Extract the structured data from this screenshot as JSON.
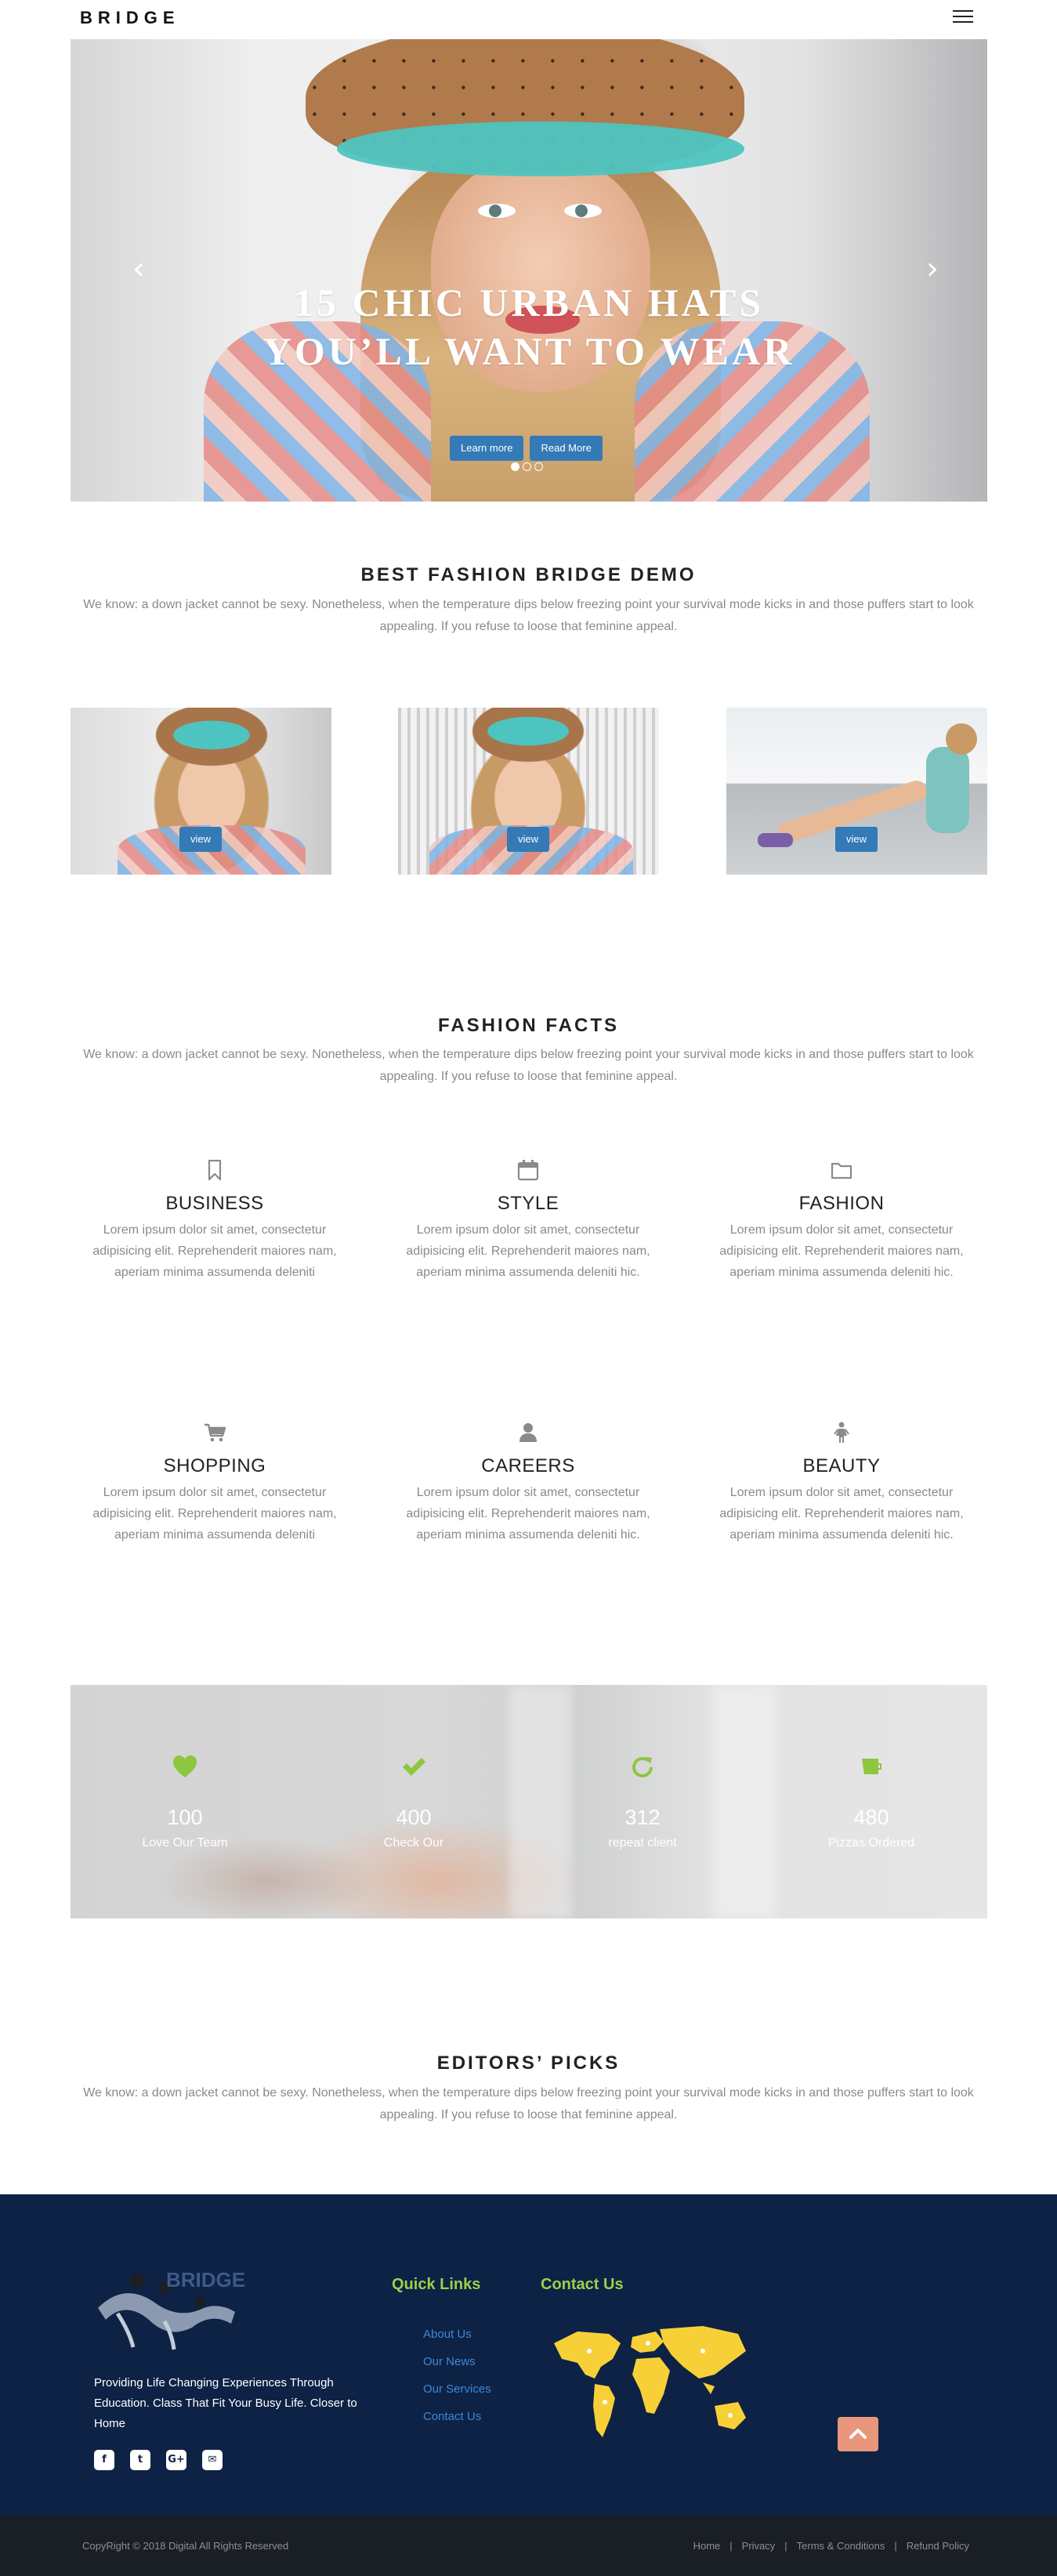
{
  "header": {
    "logo": "BRIDGE",
    "menu_icon": "hamburger-menu-icon"
  },
  "hero": {
    "title": "15 CHIC URBAN HATS YOU’LL WANT TO WEAR",
    "buttons": [
      "Learn more",
      "Read More"
    ],
    "prev_icon": "chevron-left-icon",
    "next_icon": "chevron-right-icon",
    "slides_total": 3,
    "active_slide": 1
  },
  "intro": {
    "title": "BEST FASHION BRIDGE DEMO",
    "description": "We know: a down jacket cannot be sexy. Nonetheless, when the temperature dips below freezing point your survival mode kicks in and those puffers start to look appealing. If you refuse to loose that feminine appeal."
  },
  "gallery": {
    "items": [
      {
        "button": "view"
      },
      {
        "button": "view"
      },
      {
        "button": "view"
      }
    ]
  },
  "facts": {
    "title": "FASHION FACTS",
    "description": "We know: a down jacket cannot be sexy. Nonetheless, when the temperature dips below freezing point your survival mode kicks in and those puffers start to look appealing. If you refuse to loose that feminine appeal.",
    "items": [
      {
        "icon": "bookmark-icon",
        "title": "BUSINESS",
        "text": "Lorem ipsum dolor sit amet, consectetur adipisicing elit. Reprehenderit maiores nam, aperiam minima assumenda deleniti"
      },
      {
        "icon": "calendar-icon",
        "title": "STYLE",
        "text": "Lorem ipsum dolor sit amet, consectetur adipisicing elit. Reprehenderit maiores nam, aperiam minima assumenda deleniti hic."
      },
      {
        "icon": "folder-icon",
        "title": "FASHION",
        "text": "Lorem ipsum dolor sit amet, consectetur adipisicing elit. Reprehenderit maiores nam, aperiam minima assumenda deleniti hic."
      },
      {
        "icon": "shopping-cart-icon",
        "title": "SHOPPING",
        "text": "Lorem ipsum dolor sit amet, consectetur adipisicing elit. Reprehenderit maiores nam, aperiam minima assumenda deleniti"
      },
      {
        "icon": "user-icon",
        "title": "CAREERS",
        "text": "Lorem ipsum dolor sit amet, consectetur adipisicing elit. Reprehenderit maiores nam, aperiam minima assumenda deleniti hic."
      },
      {
        "icon": "female-icon",
        "title": "BEAUTY",
        "text": "Lorem ipsum dolor sit amet, consectetur adipisicing elit. Reprehenderit maiores nam, aperiam minima assumenda deleniti hic."
      }
    ]
  },
  "stats": {
    "items": [
      {
        "icon": "heart-icon",
        "value": "100",
        "label": "Love Our Team"
      },
      {
        "icon": "check-icon",
        "value": "400",
        "label": "Check Our"
      },
      {
        "icon": "refresh-icon",
        "value": "312",
        "label": "repeat client"
      },
      {
        "icon": "coffee-cup-icon",
        "value": "480",
        "label": "Pizzas Ordered"
      }
    ],
    "icon_color": "#8dc63f"
  },
  "editors": {
    "title": "EDITORS’ PICKS",
    "description": "We know: a down jacket cannot be sexy. Nonetheless, when the temperature dips below freezing point your survival mode kicks in and those puffers start to look appealing. If you refuse to loose that feminine appeal."
  },
  "footer": {
    "logo": "BRIDGE",
    "about": "Providing Life Changing Experiences Through Education. Class That Fit Your Busy Life. Closer to Home",
    "socials": [
      {
        "icon": "facebook-icon",
        "glyph": "f"
      },
      {
        "icon": "twitter-icon",
        "glyph": "t"
      },
      {
        "icon": "google-plus-icon",
        "glyph": "G+"
      },
      {
        "icon": "envelope-icon",
        "glyph": "✉"
      }
    ],
    "quick_links_title": "Quick Links",
    "quick_links": [
      "About Us",
      "Our News",
      "Our Services",
      "Contact Us"
    ],
    "contact_title": "Contact Us",
    "to_top_icon": "chevron-up-icon",
    "background": "#0d2245",
    "heading_color": "#9bd04a",
    "link_color": "#3d88d8"
  },
  "bottom": {
    "copyright": "CopyRight © 2018 Digital All Rights Reserved",
    "links": [
      "Home",
      "Privacy",
      "Terms & Conditions",
      "Refund Policy"
    ]
  }
}
